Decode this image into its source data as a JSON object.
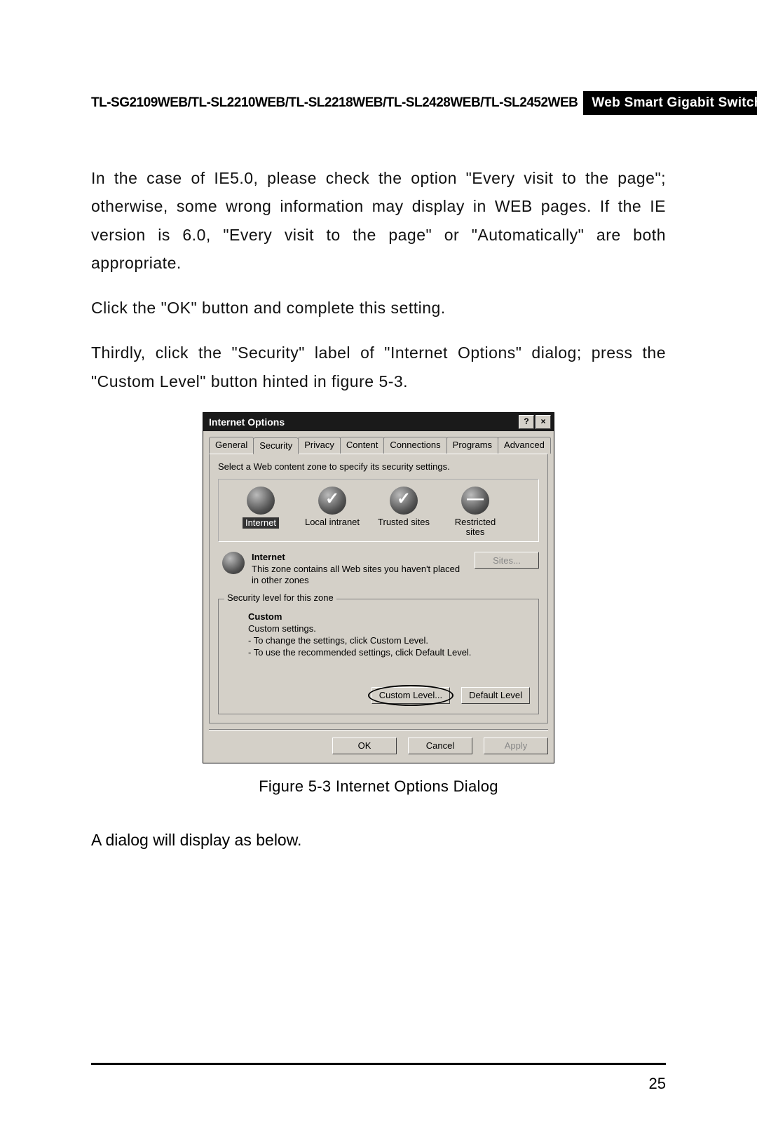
{
  "header": {
    "left": "TL-SG2109WEB/TL-SL2210WEB/TL-SL2218WEB/TL-SL2428WEB/TL-SL2452WEB",
    "right": "Web Smart Gigabit Switch Family User's Guide"
  },
  "paragraphs": {
    "p1": "In the case of IE5.0, please check the option \"Every visit to the page\"; otherwise, some wrong information may display in WEB pages. If the IE version is 6.0, \"Every visit to the page\" or \"Automatically\" are both appropriate.",
    "p2": "Click the \"OK\" button and complete this setting.",
    "p3": "Thirdly, click the \"Security\" label of \"Internet Options\" dialog; press the \"Custom Level\" button hinted in figure 5-3.",
    "p4": "A dialog will display as below."
  },
  "dialog": {
    "title": "Internet Options",
    "help_glyph": "?",
    "close_glyph": "×",
    "tabs": [
      "General",
      "Security",
      "Privacy",
      "Content",
      "Connections",
      "Programs",
      "Advanced"
    ],
    "active_tab": "Security",
    "zone_instruction": "Select a Web content zone to specify its security settings.",
    "zones": [
      {
        "label": "Internet",
        "icon": "globe",
        "selected": true
      },
      {
        "label": "Local intranet",
        "icon": "globe-check",
        "selected": false
      },
      {
        "label": "Trusted sites",
        "icon": "globe-check",
        "selected": false
      },
      {
        "label": "Restricted sites",
        "icon": "globe-minus",
        "selected": false
      }
    ],
    "zone_name": "Internet",
    "zone_desc": "This zone contains all Web sites you haven't placed in other zones",
    "sites_btn": "Sites...",
    "group_label": "Security level for this zone",
    "custom_title": "Custom",
    "custom_sub": "Custom settings.",
    "custom_line1": "- To change the settings, click Custom Level.",
    "custom_line2": "- To use the recommended settings, click Default Level.",
    "custom_level_btn": "Custom Level...",
    "default_level_btn": "Default Level",
    "ok_btn": "OK",
    "cancel_btn": "Cancel",
    "apply_btn": "Apply"
  },
  "figure_caption": "Figure 5-3  Internet Options Dialog",
  "page_number": "25"
}
